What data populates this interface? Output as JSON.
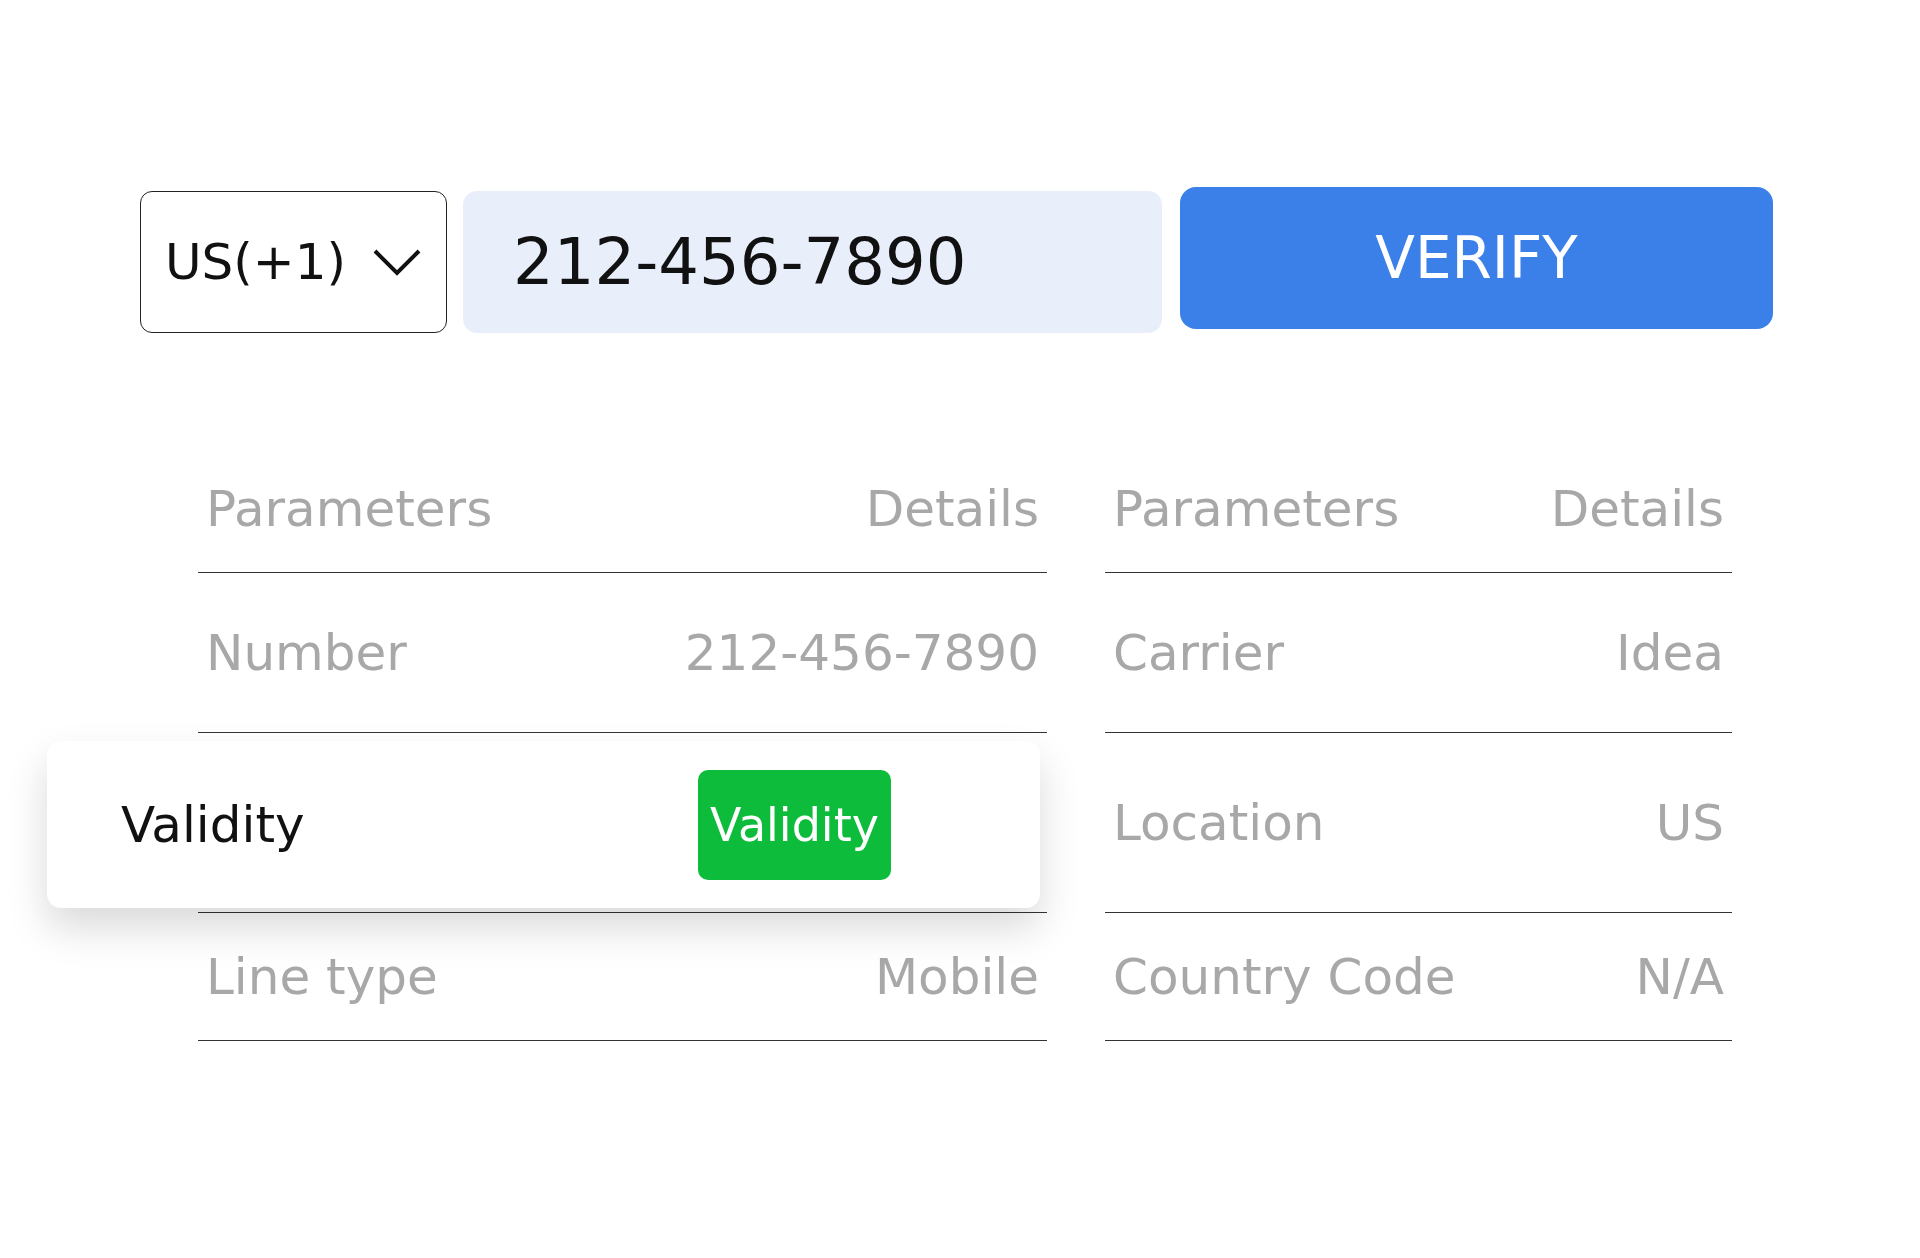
{
  "phone_form": {
    "country_code": "US(+1)",
    "phone_number": "212-456-7890",
    "verify_button": "VERIFY"
  },
  "left_table": {
    "columns": [
      "Parameters",
      "Details"
    ],
    "rows": [
      {
        "parameter": "Number",
        "detail": "212-456-7890"
      },
      {
        "parameter": "Line type",
        "detail": "Mobile"
      }
    ]
  },
  "right_table": {
    "columns": [
      "Parameters",
      "Details"
    ],
    "rows": [
      {
        "parameter": "Carrier",
        "detail": "Idea"
      },
      {
        "parameter": "Location",
        "detail": "US"
      },
      {
        "parameter": "Country Code",
        "detail": "N/A"
      }
    ]
  },
  "validity_card": {
    "label": "Validity",
    "badge": "Validity"
  }
}
